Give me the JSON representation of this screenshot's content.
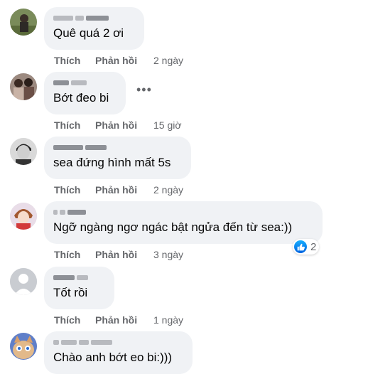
{
  "actions": {
    "like_label": "Thích",
    "reply_label": "Phản hồi"
  },
  "comments": [
    {
      "text": "Quê quá 2 ơi",
      "time": "2 ngày"
    },
    {
      "text": "Bớt đeo bi",
      "time": "15 giờ"
    },
    {
      "text": "sea đứng hình mất 5s",
      "time": "2 ngày"
    },
    {
      "text": "Ngỡ ngàng ngơ ngác bật ngửa đến từ sea:))",
      "time": "3 ngày",
      "reactions": {
        "count": "2",
        "icon": "like-icon"
      }
    },
    {
      "text": "Tốt rồi",
      "time": "1 ngày"
    },
    {
      "text": "Chào anh bớt eo bi:)))",
      "time": ""
    }
  ],
  "more_label": "•••",
  "colors": {
    "bubble": "#f0f2f5",
    "muted": "#65676b",
    "text": "#050505",
    "like_blue": "#1877f2"
  }
}
